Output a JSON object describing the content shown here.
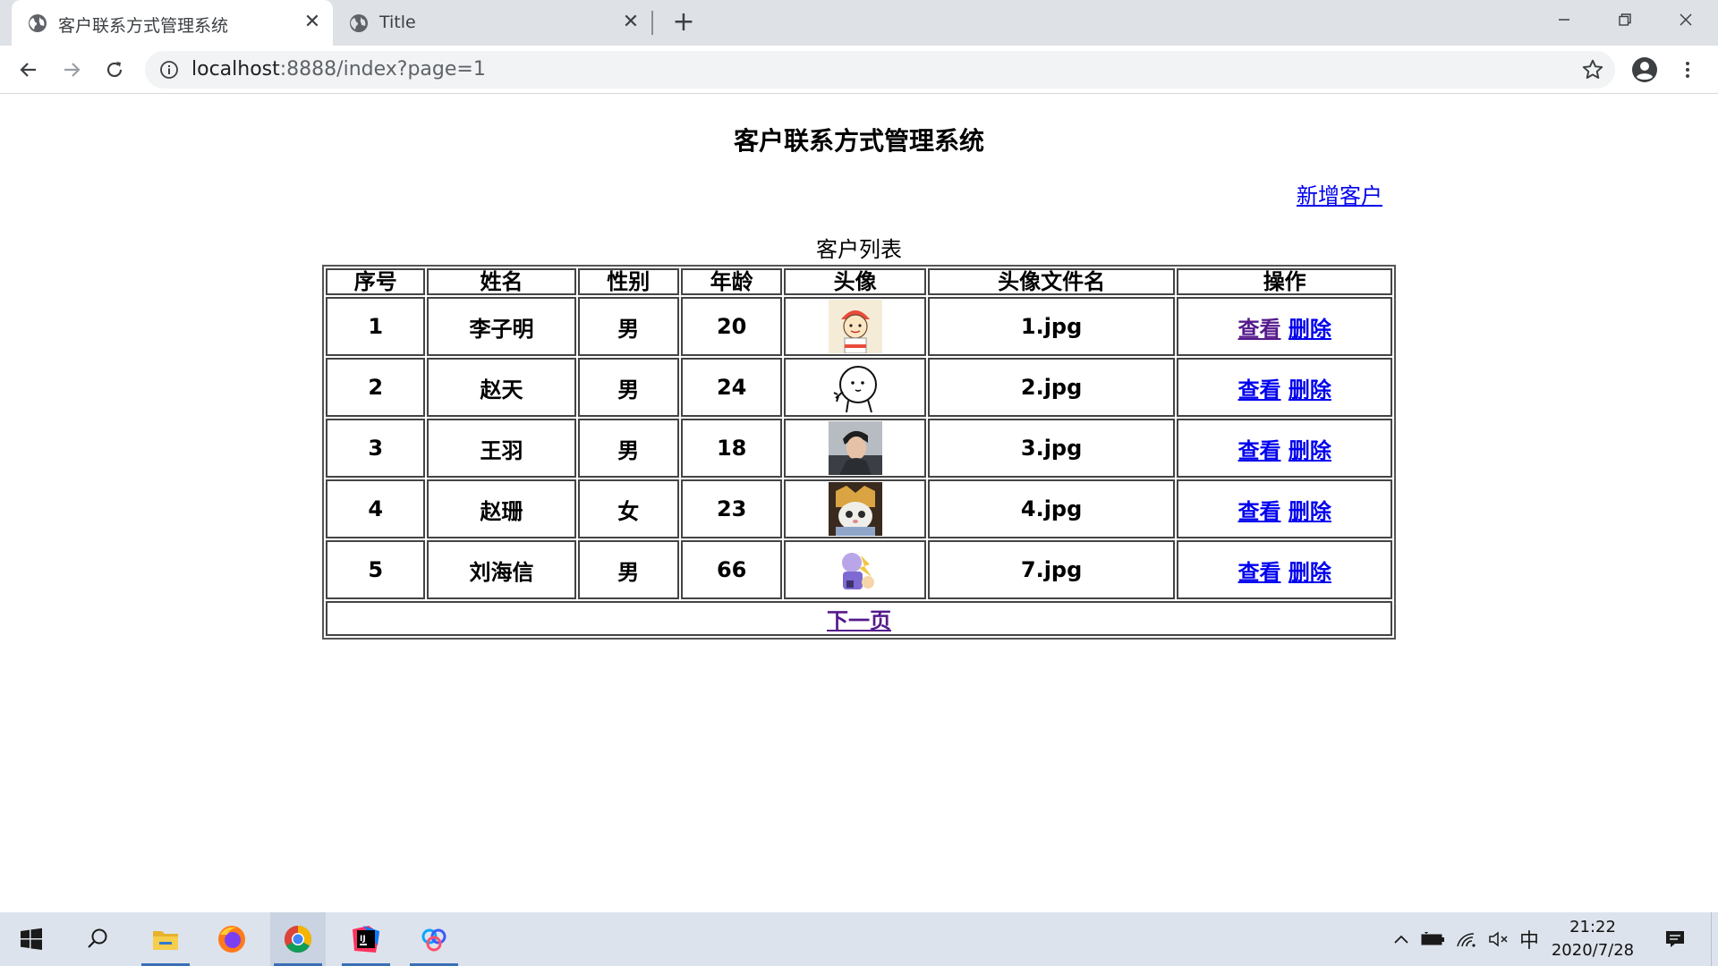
{
  "browser": {
    "tabs": [
      {
        "title": "客户联系方式管理系统",
        "active": true
      },
      {
        "title": "Title",
        "active": false
      }
    ],
    "new_tab_label": "+",
    "close_label": "✕",
    "url_host": "localhost",
    "url_path": ":8888/index?page=1"
  },
  "page": {
    "title": "客户联系方式管理系统",
    "add_customer_link": "新增客户",
    "table_caption": "客户列表",
    "columns": [
      "序号",
      "姓名",
      "性别",
      "年龄",
      "头像",
      "头像文件名",
      "操作"
    ],
    "rows": [
      {
        "no": "1",
        "name": "李子明",
        "gender": "男",
        "age": "20",
        "avatar_file": "1.jpg",
        "view": "查看",
        "delete": "删除"
      },
      {
        "no": "2",
        "name": "赵天",
        "gender": "男",
        "age": "24",
        "avatar_file": "2.jpg",
        "view": "查看",
        "delete": "删除"
      },
      {
        "no": "3",
        "name": "王羽",
        "gender": "男",
        "age": "18",
        "avatar_file": "3.jpg",
        "view": "查看",
        "delete": "删除"
      },
      {
        "no": "4",
        "name": "赵珊",
        "gender": "女",
        "age": "23",
        "avatar_file": "4.jpg",
        "view": "查看",
        "delete": "删除"
      },
      {
        "no": "5",
        "name": "刘海信",
        "gender": "男",
        "age": "66",
        "avatar_file": "7.jpg",
        "view": "查看",
        "delete": "删除"
      }
    ],
    "next_page_link": "下一页"
  },
  "taskbar": {
    "ime_label": "中",
    "time": "21:22",
    "date": "2020/7/28"
  },
  "colors": {
    "link": "#0000ee",
    "visited_link": "#551a8b",
    "tabstrip": "#dee1e6",
    "taskbar": "#dde3ec"
  },
  "icons": [
    "globe-icon",
    "close-icon",
    "back-icon",
    "forward-icon",
    "reload-icon",
    "info-icon",
    "star-icon",
    "profile-icon",
    "menu-icon",
    "windows-start-icon",
    "search-icon",
    "file-explorer-icon",
    "firefox-icon",
    "chrome-icon",
    "intellij-icon",
    "baidu-netdisk-icon",
    "chevron-up-icon",
    "battery-icon",
    "wifi-icon",
    "volume-muted-icon",
    "notification-icon"
  ]
}
